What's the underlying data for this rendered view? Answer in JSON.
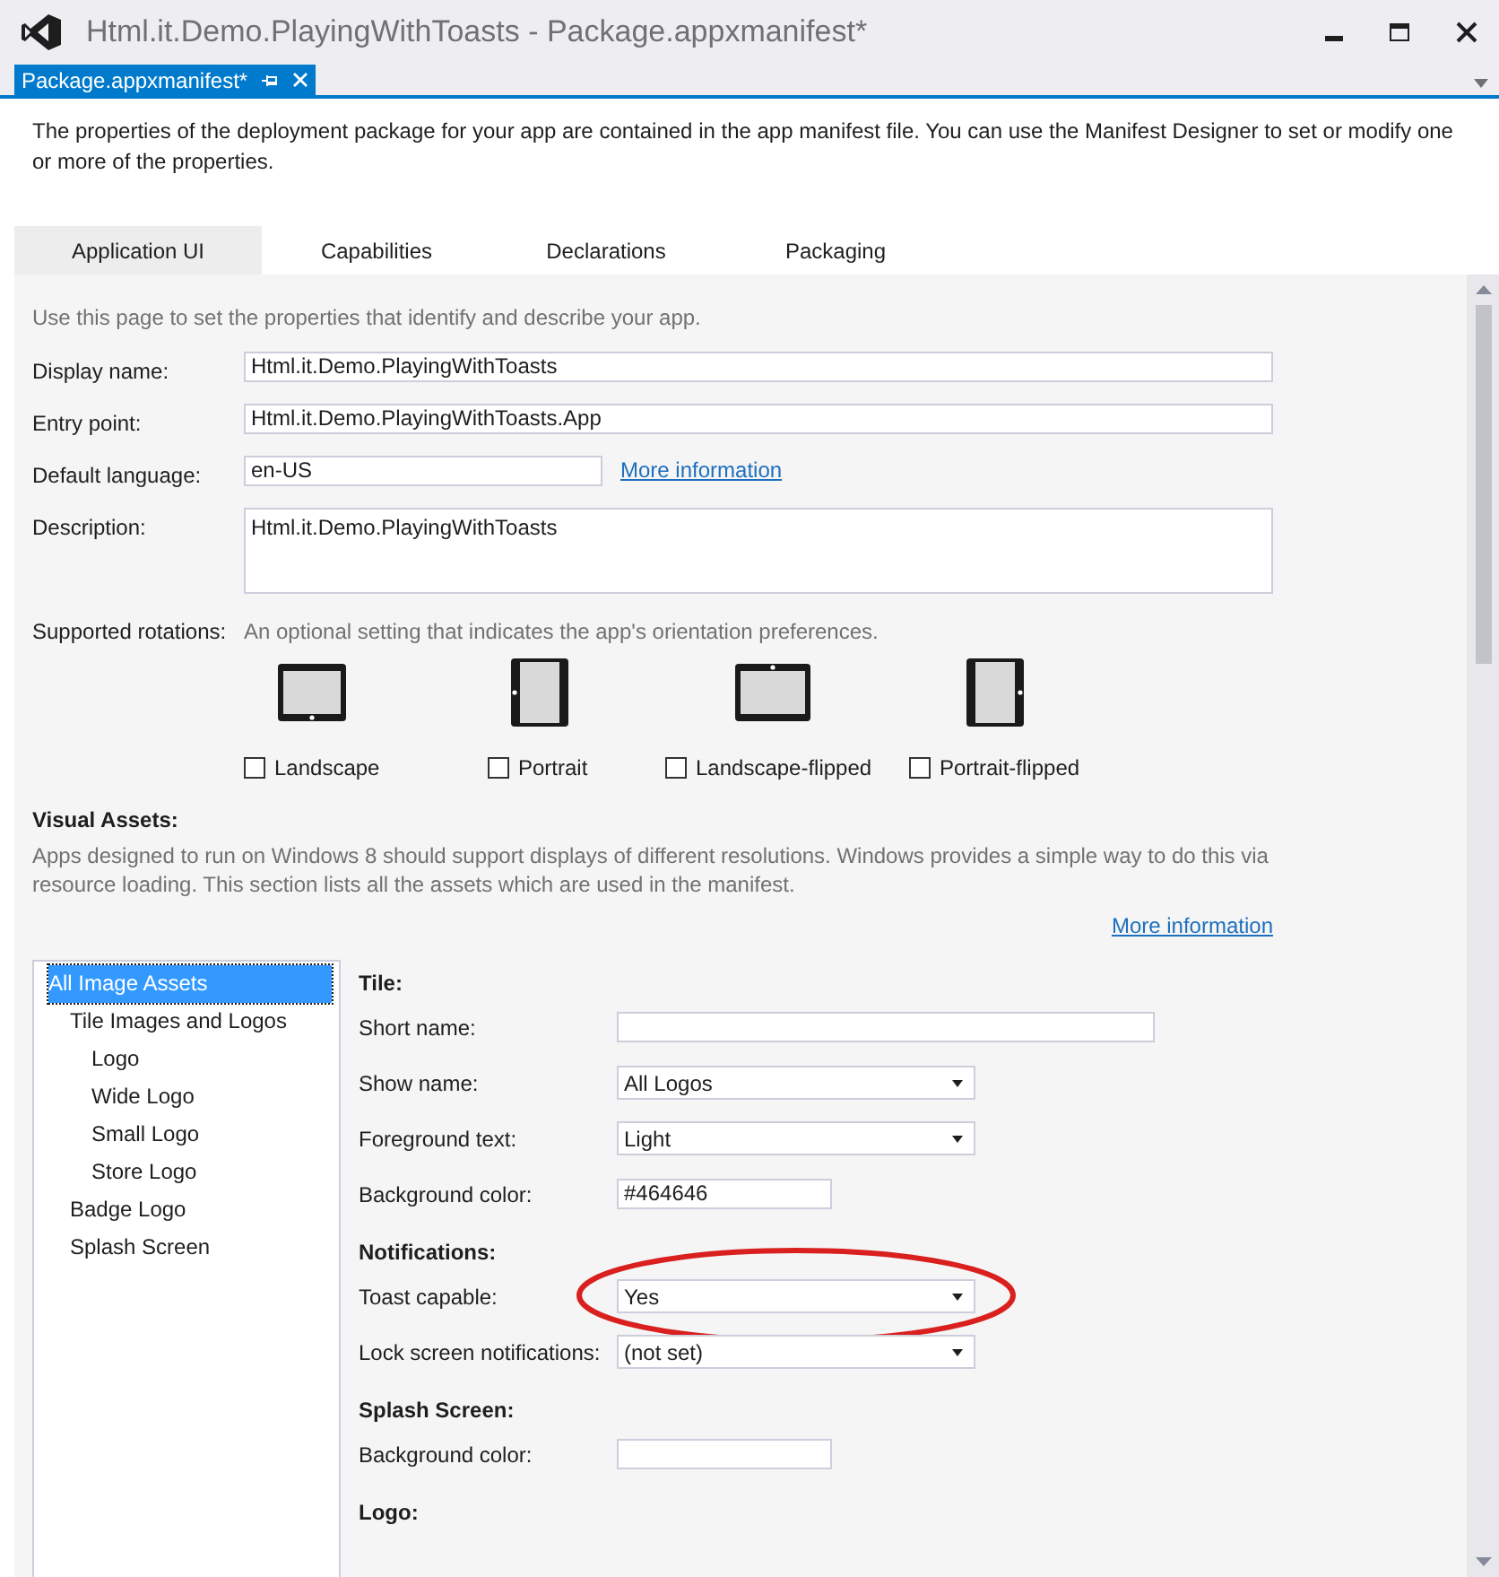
{
  "window": {
    "title": "Html.it.Demo.PlayingWithToasts - Package.appxmanifest*"
  },
  "document_tab": {
    "label": "Package.appxmanifest*",
    "selected": true
  },
  "intro": "The properties of the deployment package for your app are contained in the app manifest file. You can use the Manifest Designer to set or modify one or more of the properties.",
  "tabs": [
    {
      "label": "Application UI",
      "selected": true
    },
    {
      "label": "Capabilities",
      "selected": false
    },
    {
      "label": "Declarations",
      "selected": false
    },
    {
      "label": "Packaging",
      "selected": false
    }
  ],
  "page": {
    "hint": "Use this page to set the properties that identify and describe your app.",
    "fields": [
      {
        "label": "Display name:",
        "value": "Html.it.Demo.PlayingWithToasts",
        "kind": "text"
      },
      {
        "label": "Entry point:",
        "value": "Html.it.Demo.PlayingWithToasts.App",
        "kind": "text"
      },
      {
        "label": "Default language:",
        "value": "en-US",
        "kind": "short",
        "link": "More information"
      },
      {
        "label": "Description:",
        "value": "Html.it.Demo.PlayingWithToasts",
        "kind": "multiline"
      }
    ],
    "rotations": {
      "label": "Supported rotations:",
      "hint": "An optional setting that indicates the app's orientation preferences.",
      "options": [
        {
          "label": "Landscape",
          "kind": "landscape",
          "checked": false
        },
        {
          "label": "Portrait",
          "kind": "portrait",
          "checked": false
        },
        {
          "label": "Landscape-flipped",
          "kind": "landscape-flipped",
          "checked": false
        },
        {
          "label": "Portrait-flipped",
          "kind": "portrait-flipped",
          "checked": false
        }
      ]
    },
    "visual_assets": {
      "heading": "Visual Assets:",
      "text": "Apps designed to run on Windows 8 should support displays of different resolutions. Windows provides a simple way to do this via resource loading. This section lists all the assets which are used in the manifest.",
      "link": "More information"
    }
  },
  "asset_tree": [
    {
      "label": "All Image Assets",
      "selected": true,
      "children": [
        {
          "label": "Tile Images and Logos",
          "selected": false,
          "children": [
            {
              "label": "Logo",
              "selected": false
            },
            {
              "label": "Wide Logo",
              "selected": false
            },
            {
              "label": "Small Logo",
              "selected": false
            },
            {
              "label": "Store Logo",
              "selected": false
            }
          ]
        },
        {
          "label": "Badge Logo",
          "selected": false
        },
        {
          "label": "Splash Screen",
          "selected": false
        }
      ]
    }
  ],
  "sections": [
    {
      "heading": "Tile:",
      "fields": [
        {
          "label": "Short name:",
          "kind": "text",
          "circled": false
        },
        {
          "label": "Show name:",
          "kind": "select",
          "value": "All Logos",
          "circled": false
        },
        {
          "label": "Foreground text:",
          "kind": "select",
          "value": "Light",
          "circled": false
        },
        {
          "label": "Background color:",
          "kind": "color",
          "value": "#464646",
          "circled": false
        }
      ]
    },
    {
      "heading": "Notifications:",
      "fields": [
        {
          "label": "Toast capable:",
          "kind": "select",
          "value": "Yes",
          "circled": true
        },
        {
          "label": "Lock screen notifications:",
          "kind": "select",
          "value": "(not set)",
          "circled": false
        }
      ]
    },
    {
      "heading": "Splash Screen:",
      "fields": [
        {
          "label": "Background color:",
          "kind": "color",
          "circled": false
        }
      ]
    },
    {
      "heading": "Logo:"
    }
  ]
}
